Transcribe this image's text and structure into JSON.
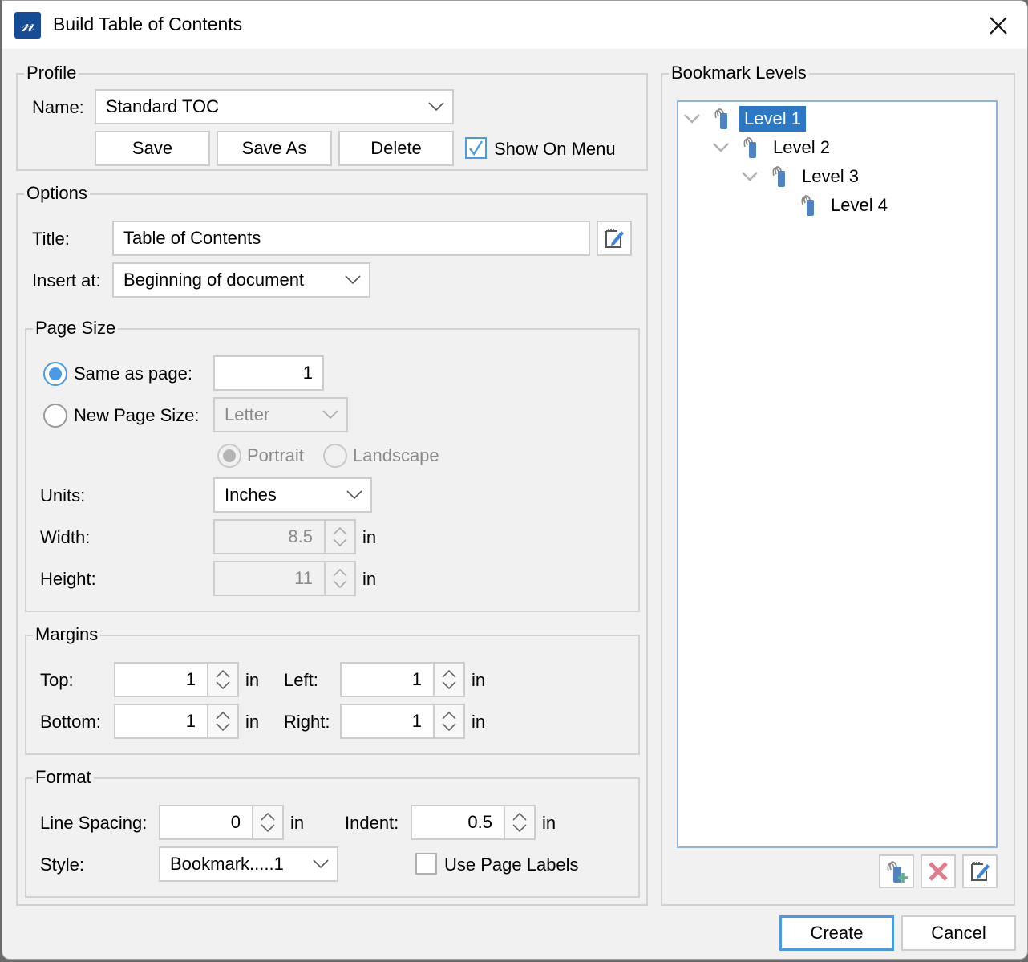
{
  "window": {
    "title": "Build Table of Contents",
    "app_icon_glyph": "𝓃",
    "close_icon": "close-icon"
  },
  "profile": {
    "legend": "Profile",
    "name_label": "Name:",
    "name_value": "Standard TOC",
    "save_label": "Save",
    "save_as_label": "Save As",
    "delete_label": "Delete",
    "show_on_menu_label": "Show On Menu",
    "show_on_menu_checked": true
  },
  "options": {
    "legend": "Options",
    "title_label": "Title:",
    "title_value": "Table of Contents",
    "title_edit_icon": "edit-notepad-icon",
    "insert_at_label": "Insert at:",
    "insert_at_value": "Beginning of document"
  },
  "page_size": {
    "legend": "Page Size",
    "same_as_page_label": "Same as page:",
    "same_as_page_selected": true,
    "same_as_page_value": "1",
    "new_page_size_label": "New Page Size:",
    "new_page_size_selected": false,
    "new_page_size_value": "Letter",
    "portrait_label": "Portrait",
    "portrait_selected": true,
    "landscape_label": "Landscape",
    "landscape_selected": false,
    "units_label": "Units:",
    "units_value": "Inches",
    "width_label": "Width:",
    "width_value": "8.5",
    "width_unit": "in",
    "height_label": "Height:",
    "height_value": "11",
    "height_unit": "in"
  },
  "margins": {
    "legend": "Margins",
    "top_label": "Top:",
    "top_value": "1",
    "top_unit": "in",
    "left_label": "Left:",
    "left_value": "1",
    "left_unit": "in",
    "bottom_label": "Bottom:",
    "bottom_value": "1",
    "bottom_unit": "in",
    "right_label": "Right:",
    "right_value": "1",
    "right_unit": "in"
  },
  "format": {
    "legend": "Format",
    "line_spacing_label": "Line Spacing:",
    "line_spacing_value": "0",
    "line_spacing_unit": "in",
    "indent_label": "Indent:",
    "indent_value": "0.5",
    "indent_unit": "in",
    "style_label": "Style:",
    "style_value": "Bookmark.....1",
    "use_page_labels_label": "Use Page Labels",
    "use_page_labels_checked": false
  },
  "bookmark_levels": {
    "legend": "Bookmark Levels",
    "items": [
      {
        "label": "Level 1",
        "selected": true,
        "expanded": true
      },
      {
        "label": "Level 2",
        "selected": false,
        "expanded": true
      },
      {
        "label": "Level 3",
        "selected": false,
        "expanded": true
      },
      {
        "label": "Level 4",
        "selected": false,
        "expanded": false
      }
    ],
    "add_level_icon": "add-bookmark-icon",
    "delete_level_icon": "delete-x-icon",
    "edit_level_icon": "edit-notepad-icon"
  },
  "footer": {
    "create_label": "Create",
    "cancel_label": "Cancel"
  },
  "colors": {
    "accent": "#4a9ae6",
    "selection": "#2a78c6",
    "app_icon": "#144c96",
    "delete_red": "#e07b8c",
    "add_green": "#5fae8a"
  }
}
